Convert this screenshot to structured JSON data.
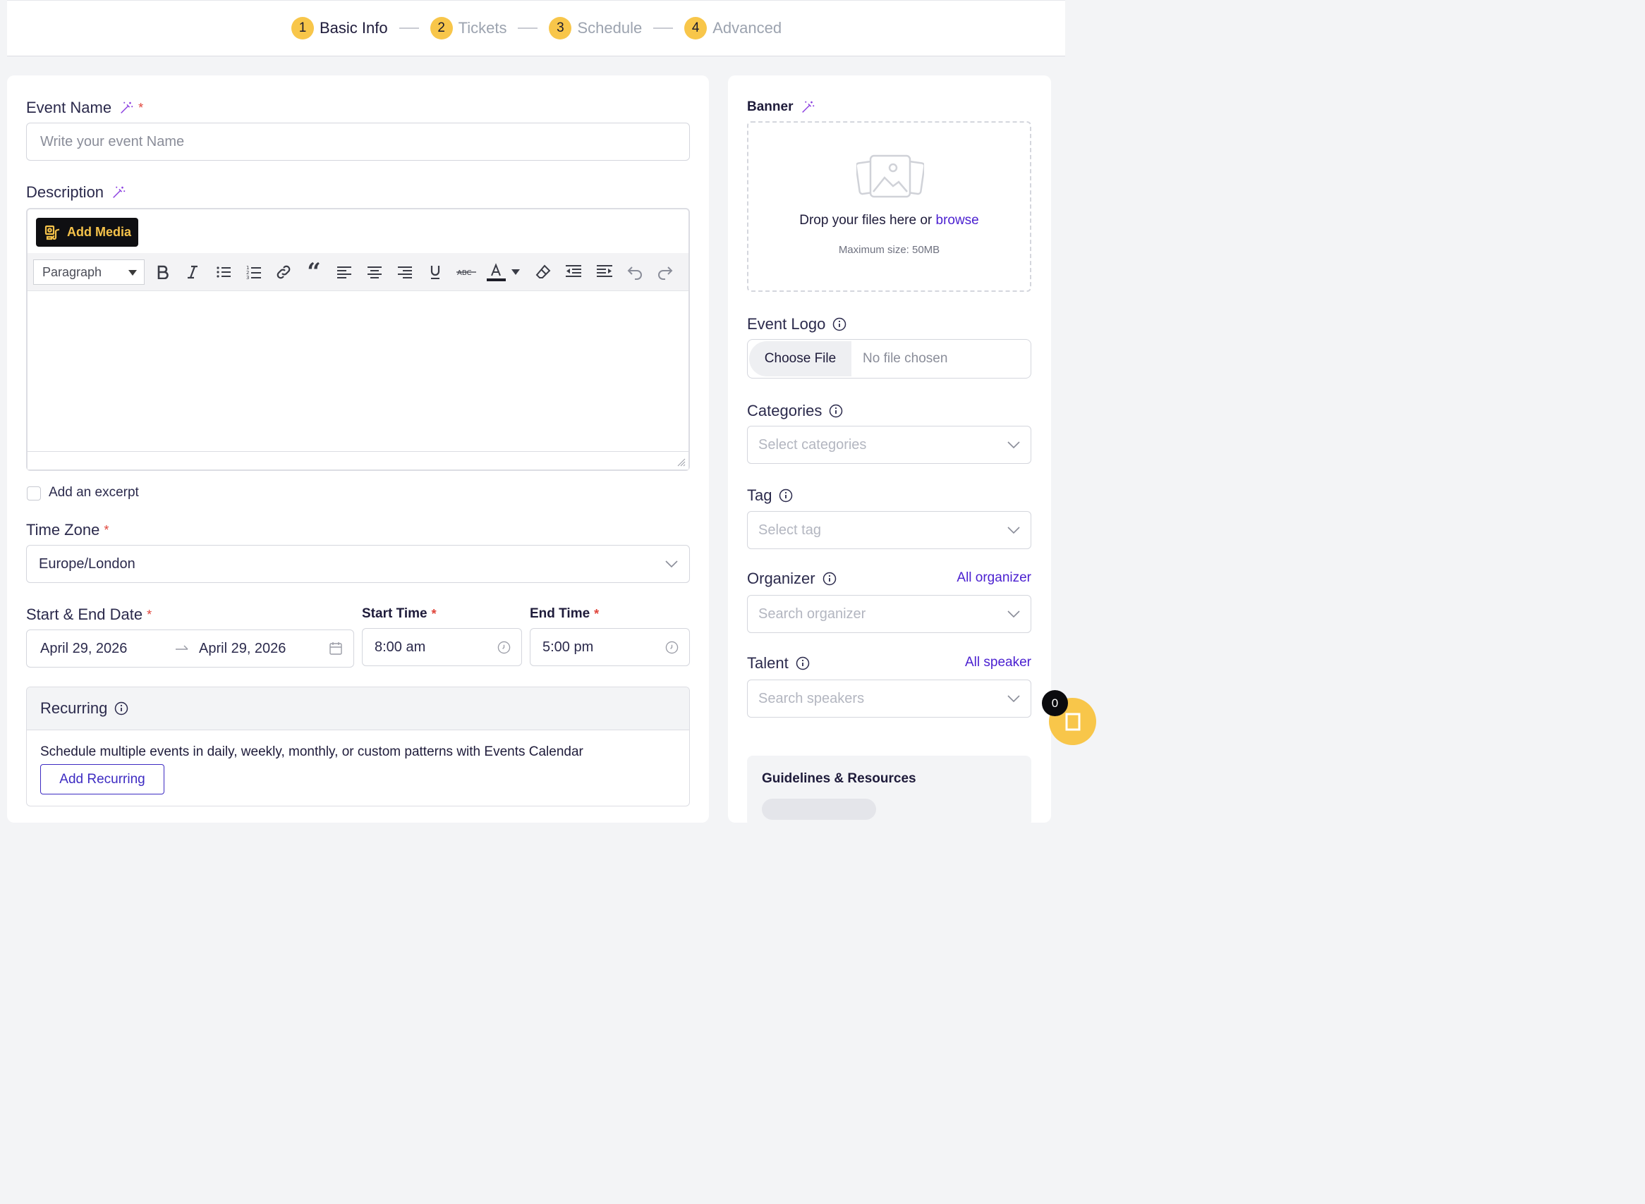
{
  "stepper": {
    "steps": [
      {
        "num": "1",
        "label": "Basic Info"
      },
      {
        "num": "2",
        "label": "Tickets"
      },
      {
        "num": "3",
        "label": "Schedule"
      },
      {
        "num": "4",
        "label": "Advanced"
      }
    ]
  },
  "event_name": {
    "label": "Event Name",
    "required": "*",
    "placeholder": "Write your event Name"
  },
  "description": {
    "label": "Description",
    "add_media": "Add Media",
    "format_select": "Paragraph"
  },
  "excerpt": {
    "label": "Add an excerpt"
  },
  "timezone": {
    "label": "Time Zone",
    "required": "*",
    "value": "Europe/London"
  },
  "dates": {
    "label": "Start & End Date",
    "required": "*",
    "start": "April 29, 2026",
    "end": "April 29, 2026"
  },
  "start_time": {
    "label": "Start Time",
    "required": "*",
    "value": "8:00 am"
  },
  "end_time": {
    "label": "End Time",
    "required": "*",
    "value": "5:00 pm"
  },
  "recurring": {
    "title": "Recurring",
    "description": "Schedule multiple events in daily, weekly, monthly, or custom patterns with Events Calendar",
    "button": "Add Recurring"
  },
  "banner": {
    "label": "Banner",
    "drop_text": "Drop your files here or ",
    "browse": "browse",
    "max_size": "Maximum size: 50MB"
  },
  "event_logo": {
    "label": "Event Logo",
    "choose": "Choose File",
    "status": "No file chosen"
  },
  "categories": {
    "label": "Categories",
    "placeholder": "Select categories"
  },
  "tag": {
    "label": "Tag",
    "placeholder": "Select tag"
  },
  "organizer": {
    "label": "Organizer",
    "link": "All organizer",
    "placeholder": "Search organizer"
  },
  "talent": {
    "label": "Talent",
    "link": "All speaker",
    "placeholder": "Search speakers"
  },
  "guidelines": {
    "title": "Guidelines & Resources"
  },
  "cart": {
    "count": "0"
  },
  "colors": {
    "accent": "#f8c64a",
    "link": "#4a1fd0",
    "required": "#e0453b"
  }
}
